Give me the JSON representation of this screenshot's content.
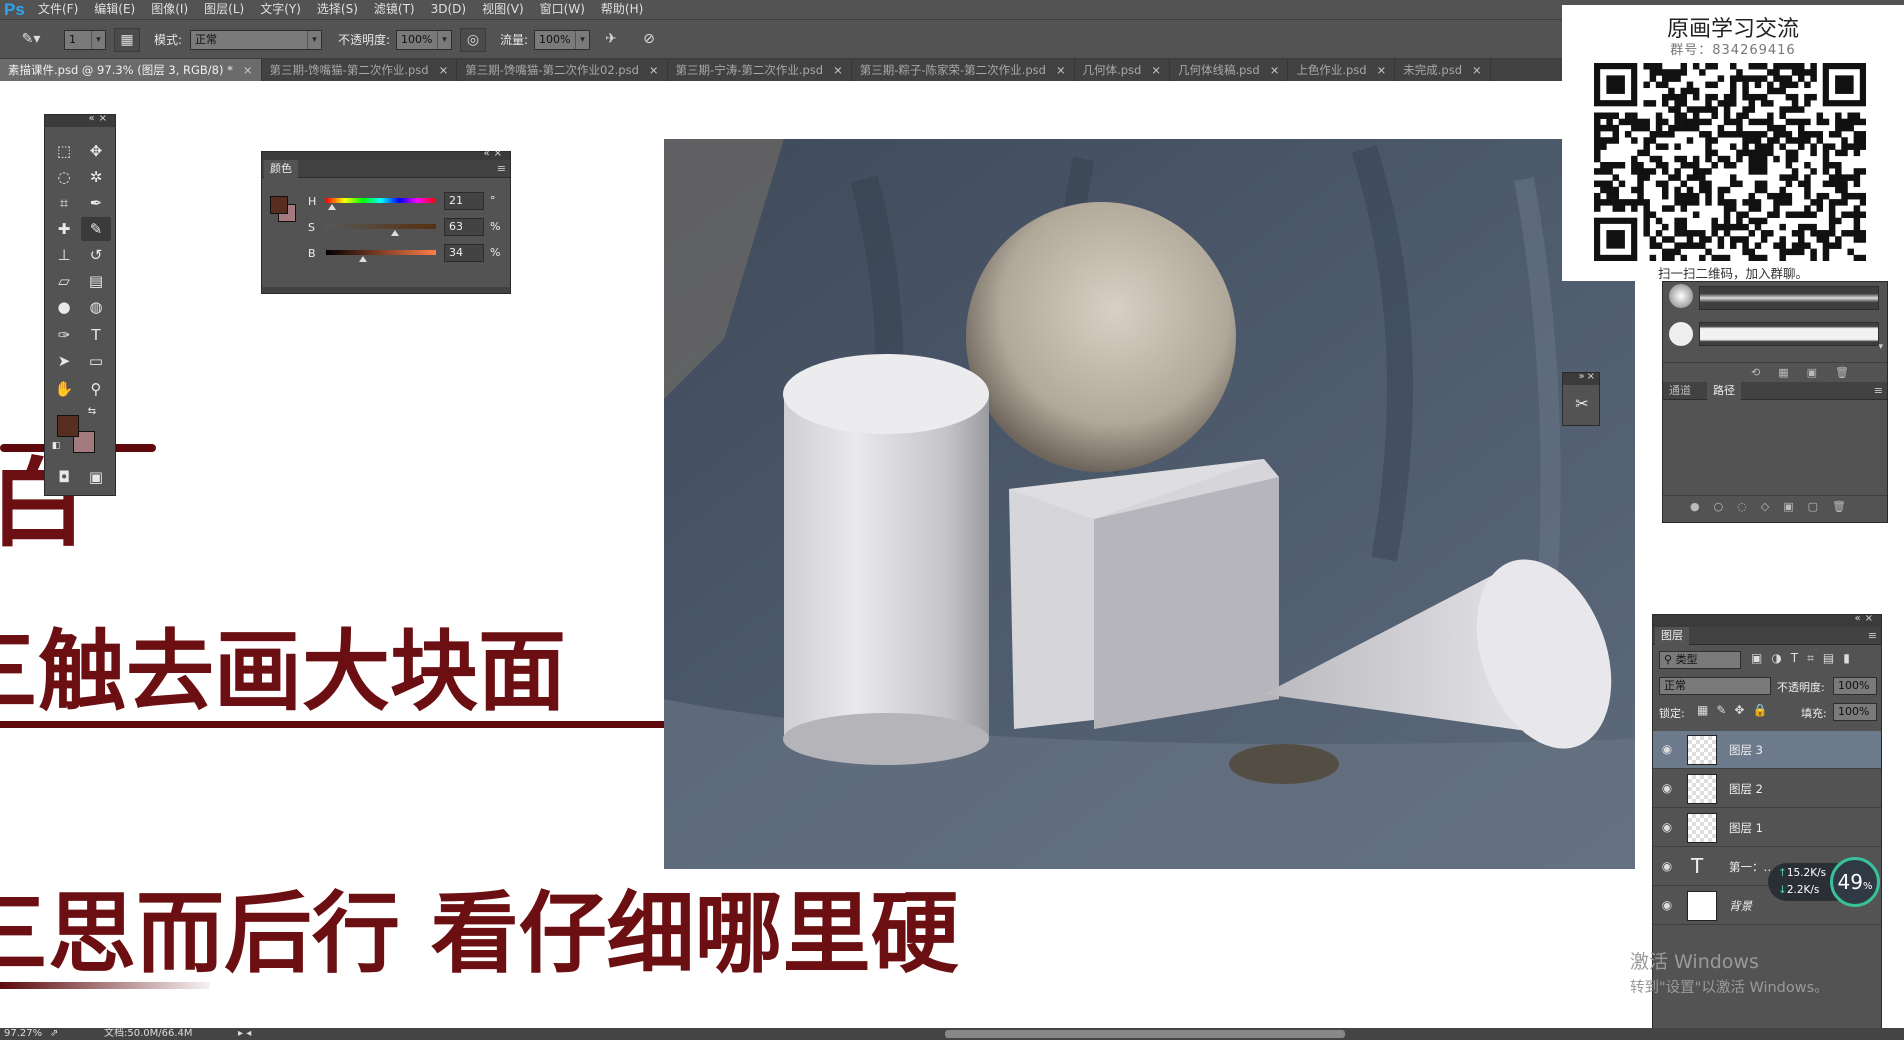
{
  "app": {
    "logo": "Ps",
    "menu": [
      "文件(F)",
      "编辑(E)",
      "图像(I)",
      "图层(L)",
      "文字(Y)",
      "选择(S)",
      "滤镜(T)",
      "3D(D)",
      "视图(V)",
      "窗口(W)",
      "帮助(H)"
    ]
  },
  "options": {
    "brush_size": "1",
    "mode_label": "模式:",
    "mode_value": "正常",
    "opacity_label": "不透明度:",
    "opacity_value": "100%",
    "flow_label": "流量:",
    "flow_value": "100%"
  },
  "tabs": [
    {
      "label": "素描课件.psd @ 97.3% (图层 3, RGB/8) *",
      "active": true
    },
    {
      "label": "第三期-馋嘴猫-第二次作业.psd"
    },
    {
      "label": "第三期-馋嘴猫-第二次作业02.psd"
    },
    {
      "label": "第三期-宁涛-第二次作业.psd"
    },
    {
      "label": "第三期-粽子-陈家荣-第二次作业.psd"
    },
    {
      "label": "几何体.psd"
    },
    {
      "label": "几何体线稿.psd"
    },
    {
      "label": "上色作业.psd"
    },
    {
      "label": "未完成.psd"
    }
  ],
  "canvas": {
    "line1": "白",
    "line2": "三触去画大块面",
    "line3": "三思而后行 看仔细哪里硬"
  },
  "color_panel": {
    "title": "颜色",
    "h_label": "H",
    "h_value": "21",
    "h_unit": "°",
    "s_label": "S",
    "s_value": "63",
    "s_unit": "%",
    "b_label": "B",
    "b_value": "34",
    "b_unit": "%",
    "h": 21,
    "s": 63,
    "b": 34
  },
  "colors": {
    "foreground": "#572e20",
    "background": "#a37a7e",
    "calligraphy": "#6b0f12"
  },
  "qr": {
    "title": "原画学习交流",
    "group": "群号：834269416",
    "caption": "扫一扫二维码，加入群聊。"
  },
  "right_panel": {
    "tab_channels": "通道",
    "tab_paths": "路径"
  },
  "layers_panel": {
    "title": "图层",
    "filter": "类型",
    "blend": "正常",
    "opacity_label": "不透明度:",
    "opacity_value": "100%",
    "lock_label": "锁定:",
    "fill_label": "填充:",
    "fill_value": "100%",
    "layers": [
      {
        "name": "图层 3",
        "selected": true
      },
      {
        "name": "图层 2"
      },
      {
        "name": "图层 1"
      },
      {
        "name": "第一：…",
        "type": "text"
      },
      {
        "name": "背景"
      }
    ]
  },
  "speed": {
    "up": "15.2K/s",
    "down": "2.2K/s",
    "percent": "49",
    "percent_unit": "%"
  },
  "status": {
    "zoom": "97.27%",
    "doc": "文档:50.0M/66.4M"
  },
  "watermark": {
    "line1": "激活 Windows",
    "line2": "转到\"设置\"以激活 Windows。"
  }
}
